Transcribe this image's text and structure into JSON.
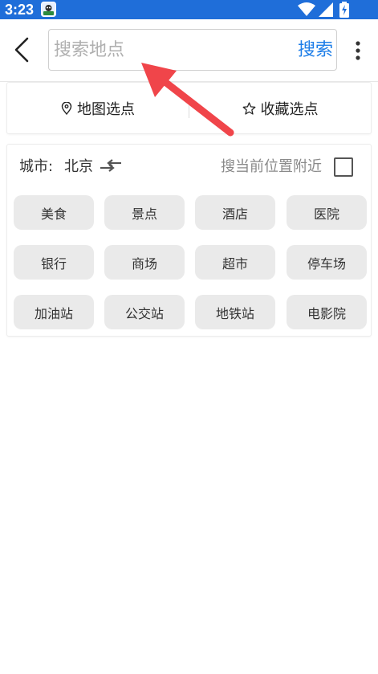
{
  "status_bar": {
    "time": "3:23",
    "background": "#1f6ed9"
  },
  "header": {
    "back_icon": "chevron-left-icon",
    "search": {
      "value": "",
      "placeholder": "搜索地点"
    },
    "search_button_label": "搜索",
    "more_icon": "more-vertical-icon",
    "accent_color": "#1e7ee8"
  },
  "tabs": [
    {
      "label": "地图选点",
      "icon": "location-pin-icon"
    },
    {
      "label": "收藏选点",
      "icon": "star-icon"
    }
  ],
  "city": {
    "label": "城市:",
    "name": "北京",
    "switch_icon": "swap-arrows-icon"
  },
  "nearby": {
    "label": "搜当前位置附近",
    "checked": false
  },
  "categories": [
    "美食",
    "景点",
    "酒店",
    "医院",
    "银行",
    "商场",
    "超市",
    "停车场",
    "加油站",
    "公交站",
    "地铁站",
    "电影院"
  ],
  "annotation_color": "#f0454a"
}
